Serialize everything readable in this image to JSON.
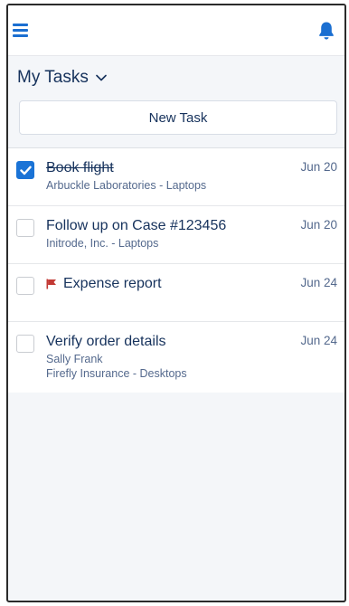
{
  "header": {
    "menu_icon": "hamburger-icon",
    "notification_icon": "bell-icon",
    "accent_color": "#1b6fd1"
  },
  "list_view": {
    "title": "My Tasks",
    "dropdown_icon": "chevron-down-icon",
    "new_task_label": "New Task"
  },
  "tasks": [
    {
      "subject": "Book flight",
      "details": [
        "Arbuckle Laboratories - Laptops"
      ],
      "date": "Jun 20",
      "completed": true,
      "flagged": false
    },
    {
      "subject": "Follow up on Case #123456",
      "details": [
        "Initrode, Inc. - Laptops"
      ],
      "date": "Jun 20",
      "completed": false,
      "flagged": false
    },
    {
      "subject": "Expense report",
      "details": [],
      "date": "Jun 24",
      "completed": false,
      "flagged": true,
      "flag_color": "#c23934"
    },
    {
      "subject": "Verify order details",
      "details": [
        "Sally Frank",
        "Firefly Insurance - Desktops"
      ],
      "date": "Jun 24",
      "completed": false,
      "flagged": false
    }
  ]
}
